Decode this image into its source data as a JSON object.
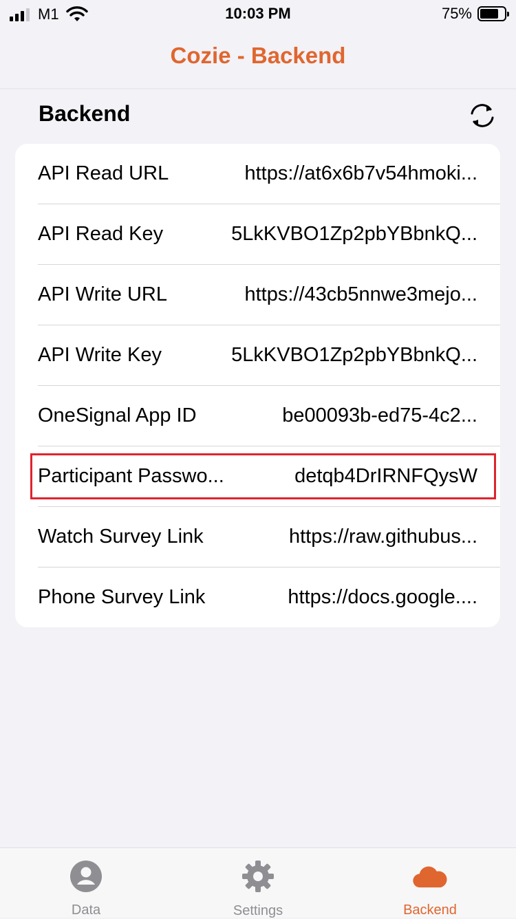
{
  "status_bar": {
    "carrier": "M1",
    "time": "10:03 PM",
    "battery_percent": "75%",
    "battery_level": 0.75
  },
  "nav": {
    "title": "Cozie - Backend"
  },
  "section": {
    "title": "Backend",
    "refresh_icon": "refresh-icon"
  },
  "rows": [
    {
      "label": "API Read URL",
      "value": "https://at6x6b7v54hmoki..."
    },
    {
      "label": "API Read Key",
      "value": "5LkKVBO1Zp2pbYBbnkQ..."
    },
    {
      "label": "API Write URL",
      "value": "https://43cb5nnwe3mejo..."
    },
    {
      "label": "API Write Key",
      "value": "5LkKVBO1Zp2pbYBbnkQ..."
    },
    {
      "label": "OneSignal App ID",
      "value": "be00093b-ed75-4c2..."
    },
    {
      "label": "Participant Passwo...",
      "value": "detqb4DrIRNFQysW"
    },
    {
      "label": "Watch Survey Link",
      "value": "https://raw.githubus..."
    },
    {
      "label": "Phone Survey Link",
      "value": "https://docs.google...."
    }
  ],
  "tabs": [
    {
      "label": "Data",
      "icon": "person-circle-icon",
      "active": false
    },
    {
      "label": "Settings",
      "icon": "gear-icon",
      "active": false
    },
    {
      "label": "Backend",
      "icon": "cloud-icon",
      "active": true
    }
  ],
  "colors": {
    "accent": "#e0662f",
    "highlight": "#e0232e",
    "inactive": "#8e8e93"
  }
}
